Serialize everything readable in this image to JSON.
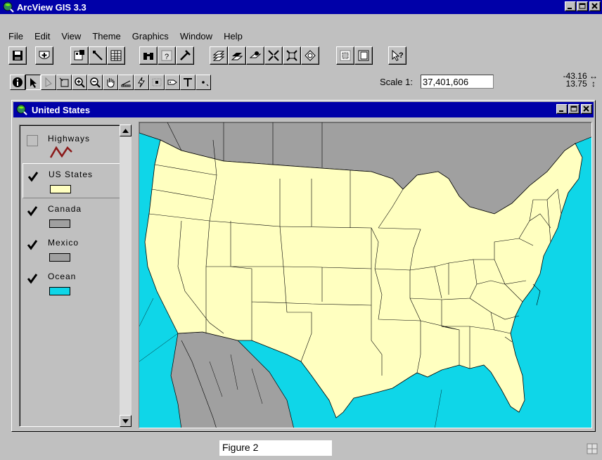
{
  "app": {
    "title": "ArcView GIS 3.3"
  },
  "menu": [
    {
      "label": "File"
    },
    {
      "label": "Edit"
    },
    {
      "label": "View"
    },
    {
      "label": "Theme"
    },
    {
      "label": "Graphics"
    },
    {
      "label": "Window"
    },
    {
      "label": "Help"
    }
  ],
  "scale": {
    "label": "Scale 1:",
    "value": "37,401,606"
  },
  "coords": {
    "x": "-43.16",
    "y": "13.75"
  },
  "view": {
    "title": "United States",
    "legend": [
      {
        "label": "Highways",
        "checked": false,
        "color": "#8b1a1a"
      },
      {
        "label": "US States",
        "checked": true,
        "color": "#ffffc0"
      },
      {
        "label": "Canada",
        "checked": true,
        "color": "#a0a0a0"
      },
      {
        "label": "Mexico",
        "checked": true,
        "color": "#a0a0a0"
      },
      {
        "label": "Ocean",
        "checked": true,
        "color": "#0fd6e8"
      }
    ]
  },
  "status": {
    "text": "Figure 2"
  },
  "colors": {
    "titlebar": "#0000a8",
    "ocean": "#0fd6e8",
    "land_us": "#ffffc0",
    "land_other": "#a0a0a0"
  }
}
